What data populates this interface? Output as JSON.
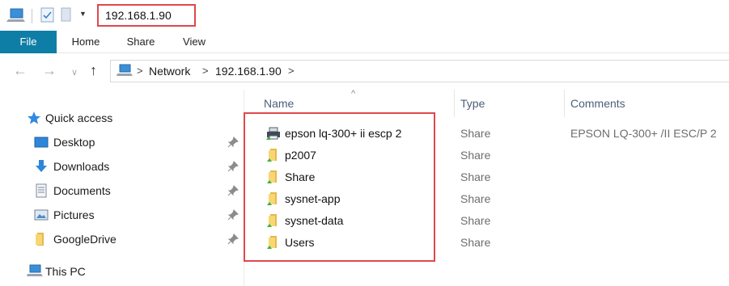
{
  "window": {
    "title_path": "192.168.1.90"
  },
  "quick_access_toolbar": {
    "icons": [
      "computer-icon",
      "properties-icon",
      "new-folder-icon",
      "customize-dropdown-icon"
    ]
  },
  "ribbon": {
    "tabs": [
      {
        "label": "File",
        "active": true
      },
      {
        "label": "Home"
      },
      {
        "label": "Share"
      },
      {
        "label": "View"
      }
    ],
    "accent_color": "#0f7ea6"
  },
  "address_bar": {
    "crumbs": [
      "Network",
      "192.168.1.90"
    ]
  },
  "nav_pane": {
    "quick_access_label": "Quick access",
    "items": [
      {
        "label": "Desktop",
        "icon": "desktop-icon",
        "pinned": true
      },
      {
        "label": "Downloads",
        "icon": "downloads-icon",
        "pinned": true
      },
      {
        "label": "Documents",
        "icon": "documents-icon",
        "pinned": true
      },
      {
        "label": "Pictures",
        "icon": "pictures-icon",
        "pinned": true
      },
      {
        "label": "GoogleDrive",
        "icon": "folder-icon",
        "pinned": true
      }
    ],
    "this_pc_label": "This PC"
  },
  "file_list": {
    "columns": {
      "name": "Name",
      "type": "Type",
      "comments": "Comments"
    },
    "rows": [
      {
        "name": "epson lq-300+ ii escp 2",
        "type": "Share",
        "comment": "EPSON LQ-300+ /II ESC/P 2",
        "icon": "printer-icon"
      },
      {
        "name": "p2007",
        "type": "Share",
        "comment": "",
        "icon": "shared-folder-icon"
      },
      {
        "name": "Share",
        "type": "Share",
        "comment": "",
        "icon": "shared-folder-icon"
      },
      {
        "name": "sysnet-app",
        "type": "Share",
        "comment": "",
        "icon": "shared-folder-icon"
      },
      {
        "name": "sysnet-data",
        "type": "Share",
        "comment": "",
        "icon": "shared-folder-icon"
      },
      {
        "name": "Users",
        "type": "Share",
        "comment": "",
        "icon": "shared-folder-icon"
      }
    ]
  },
  "highlight_color": "#e0474c"
}
